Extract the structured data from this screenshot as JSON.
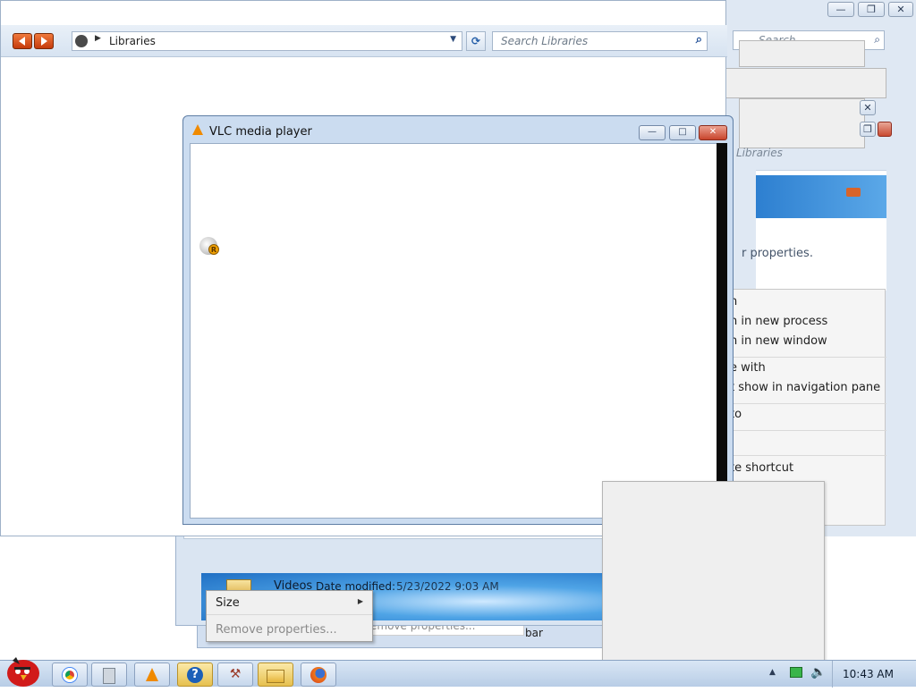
{
  "explorer": {
    "breadcrumb": "Libraries",
    "search_placeholder": "Search Libraries",
    "details_name": "Videos",
    "details_date_label": "Date modified:",
    "details_date_value": "5/23/2022 9:03 AM",
    "remove_properties_behind": "emove properties...",
    "bar_fragment": "bar"
  },
  "right_panel": {
    "libraries_fragment": "Libraries",
    "search_fragment": "Search",
    "properties_fragment": "r properties.",
    "context_items": [
      "n",
      "n in new process",
      "n in new window",
      "e with",
      "t show in navigation pane",
      "to",
      "te shortcut"
    ]
  },
  "vlc": {
    "title": "VLC media player",
    "minimize_glyph": "—",
    "maximize_glyph": "□",
    "close_glyph": "✕"
  },
  "context_menu": {
    "items": [
      {
        "label": "Size",
        "has_submenu": true,
        "enabled": true
      },
      {
        "label": "Remove properties...",
        "has_submenu": false,
        "enabled": false
      }
    ]
  },
  "taskbar": {
    "clock": "10:43 AM",
    "buttons": [
      {
        "icon": "chrome-icon"
      },
      {
        "icon": "calculator-icon"
      },
      {
        "icon": "vlc-icon"
      },
      {
        "icon": "help-icon"
      },
      {
        "icon": "tools-icon"
      },
      {
        "icon": "folder-icon",
        "active": true
      },
      {
        "icon": "firefox-icon"
      }
    ]
  },
  "colors": {
    "accent_blue": "#1f6fc4",
    "vlc_orange": "#f08a00",
    "nav_orange": "#e0561c",
    "close_red": "#c94a31"
  }
}
